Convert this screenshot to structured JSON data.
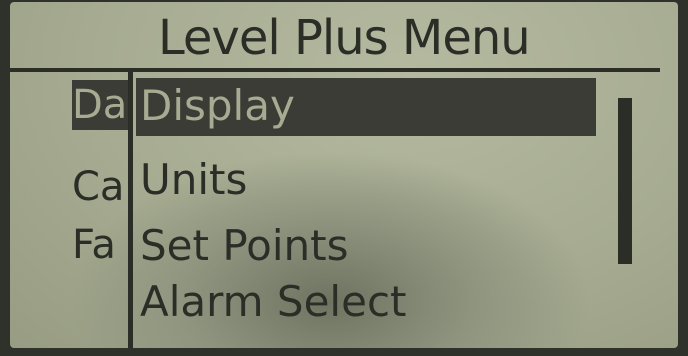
{
  "screen": {
    "title": "Level Plus Menu"
  },
  "parent_menu": {
    "items": [
      {
        "label": "Da",
        "selected": true
      },
      {
        "label": "Ca",
        "selected": false
      },
      {
        "label": "Fa",
        "selected": false
      }
    ]
  },
  "submenu": {
    "items": [
      {
        "label": "Display",
        "selected": true
      },
      {
        "label": "Units",
        "selected": false
      },
      {
        "label": "Set Points",
        "selected": false
      },
      {
        "label": "Alarm Select",
        "selected": false
      }
    ]
  },
  "colors": {
    "lcd_background": "#a6ab91",
    "lcd_text": "#2b2d27",
    "highlight": "#3b3c36"
  }
}
